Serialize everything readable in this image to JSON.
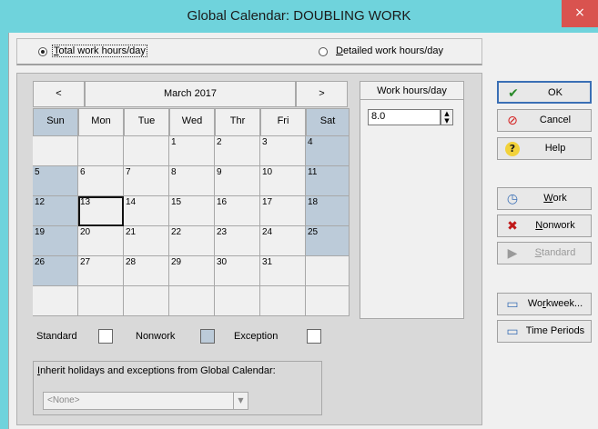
{
  "window": {
    "title": "Global Calendar: DOUBLING WORK",
    "close_label": "×"
  },
  "mode": {
    "total_label": "Total work hours/day",
    "total_selected": true,
    "detailed_label": "Detailed work hours/day",
    "detailed_selected": false
  },
  "calendar": {
    "prev_label": "<",
    "next_label": ">",
    "month_label": "March 2017",
    "weekdays": [
      "Sun",
      "Mon",
      "Tue",
      "Wed",
      "Thr",
      "Fri",
      "Sat"
    ],
    "weeks": [
      [
        "",
        "",
        "",
        "1",
        "2",
        "3",
        "4"
      ],
      [
        "5",
        "6",
        "7",
        "8",
        "9",
        "10",
        "11"
      ],
      [
        "12",
        "13",
        "14",
        "15",
        "16",
        "17",
        "18"
      ],
      [
        "19",
        "20",
        "21",
        "22",
        "23",
        "24",
        "25"
      ],
      [
        "26",
        "27",
        "28",
        "29",
        "30",
        "31",
        ""
      ],
      [
        "",
        "",
        "",
        "",
        "",
        "",
        ""
      ]
    ],
    "selected_day": "13"
  },
  "work_hours": {
    "header": "Work hours/day",
    "value": "8.0"
  },
  "legend": {
    "standard_label": "Standard",
    "nonwork_label": "Nonwork",
    "exception_label": "Exception",
    "standard_color": "#ffffff",
    "nonwork_color": "#bccbd9",
    "exception_color": "#ffffff"
  },
  "inherit": {
    "label": "Inherit holidays and exceptions from Global Calendar:",
    "selected": "<None>"
  },
  "buttons": {
    "ok": "OK",
    "cancel": "Cancel",
    "help": "Help",
    "work": "Work",
    "nonwork": "Nonwork",
    "standard": "Standard",
    "workweek": "Workweek...",
    "time_periods": "Time Periods"
  },
  "colors": {
    "titlebar": "#6fd3dc",
    "weekend": "#bccbd9"
  }
}
